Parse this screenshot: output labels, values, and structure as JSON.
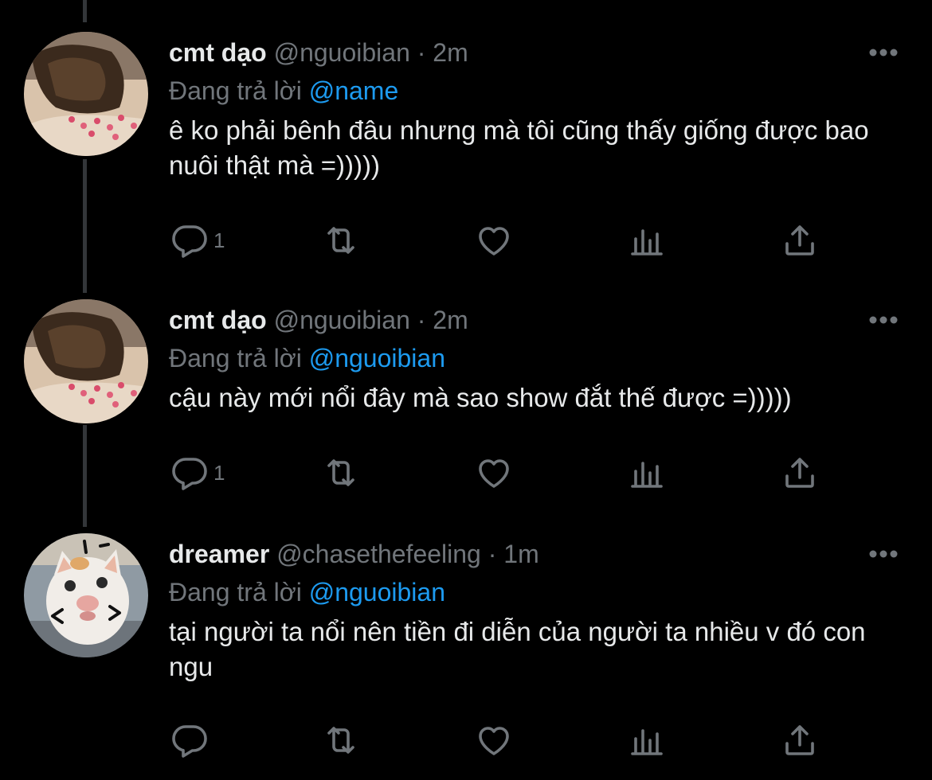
{
  "colors": {
    "background": "#000000",
    "primary_text": "#e7e9ea",
    "secondary_text": "#71767b",
    "accent": "#1d9bf0",
    "thread_line": "#333639"
  },
  "tweets": [
    {
      "display_name": "cmt dạo",
      "handle": "@nguoibian",
      "separator": "·",
      "time": "2m",
      "reply_prefix": "Đang trả lời",
      "reply_to": "@name",
      "text": "ê ko phải bênh đâu nhưng mà tôi cũng thấy giống được bao nuôi thật mà =)))))",
      "reply_count": "1",
      "avatar_icon": "cat-on-pillow-avatar"
    },
    {
      "display_name": "cmt dạo",
      "handle": "@nguoibian",
      "separator": "·",
      "time": "2m",
      "reply_prefix": "Đang trả lời",
      "reply_to": "@nguoibian",
      "text": "cậu này mới nổi đây mà sao show đắt thế được =)))))",
      "reply_count": "1",
      "avatar_icon": "cat-on-pillow-avatar"
    },
    {
      "display_name": "dreamer",
      "handle": "@chasethefeeling",
      "separator": "·",
      "time": "1m",
      "reply_prefix": "Đang trả lời",
      "reply_to": "@nguoibian",
      "text": "tại người ta nổi nên tiền đi diễn của người ta nhiều v đó con ngu",
      "reply_count": "",
      "avatar_icon": "white-kitten-avatar"
    }
  ],
  "action_icons": [
    "reply-icon",
    "retweet-icon",
    "like-icon",
    "analytics-icon",
    "share-icon"
  ]
}
